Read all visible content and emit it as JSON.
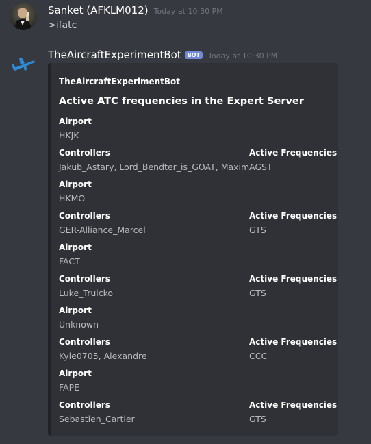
{
  "messages": [
    {
      "author": "Sanket (AFKLM012)",
      "timestamp": "Today at 10:30 PM",
      "content": ">ifatc"
    },
    {
      "author": "TheAircraftExperimentBot",
      "badge": "BOT",
      "timestamp": "Today at 10:30 PM"
    }
  ],
  "embed": {
    "author": "TheAircraftExperimentBot",
    "title": "Active ATC frequencies in the Expert Server",
    "label_airport": "Airport",
    "label_controllers": "Controllers",
    "label_frequencies": "Active Frequencies",
    "entries": [
      {
        "airport": "HKJK",
        "controllers": "Jakub_Astary, Lord_Bendter_is_GOAT, Maxim",
        "frequencies": "AGST"
      },
      {
        "airport": "HKMO",
        "controllers": "GER-Alliance_Marcel",
        "frequencies": "GTS"
      },
      {
        "airport": "FACT",
        "controllers": "Luke_Truicko",
        "frequencies": "GTS"
      },
      {
        "airport": "Unknown",
        "controllers": "Kyle0705, Alexandre",
        "frequencies": "CCC"
      },
      {
        "airport": "FAPE",
        "controllers": "Sebastien_Cartier",
        "frequencies": "GTS"
      }
    ]
  },
  "colors": {
    "background": "#36393f",
    "embed_background": "#2f3136",
    "embed_border": "#202225",
    "bot_badge": "#7289da",
    "bot_avatar_plane": "#2e8bd6"
  },
  "icons": {
    "user_avatar": "user-avatar-photo",
    "bot_avatar": "airplane-icon"
  }
}
